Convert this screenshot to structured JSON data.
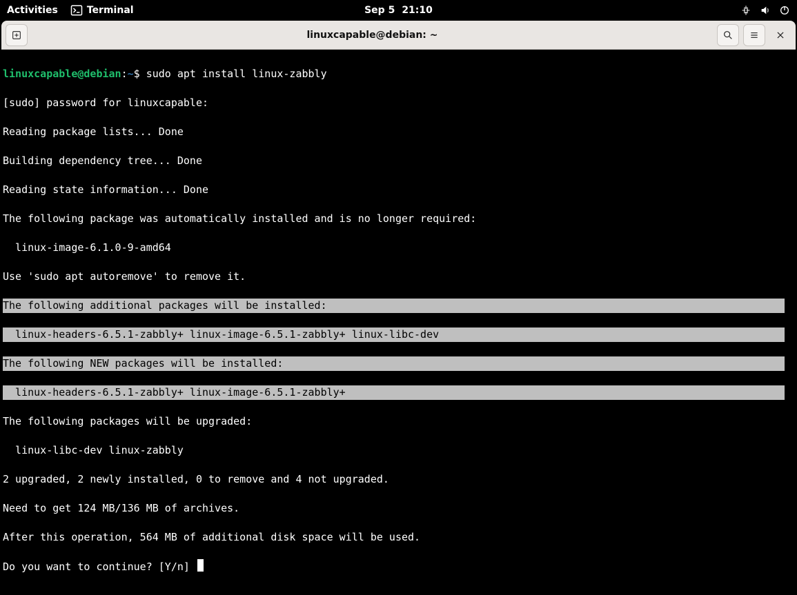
{
  "topbar": {
    "activities": "Activities",
    "app_label": "Terminal",
    "date": "Sep 5",
    "time": "21:10"
  },
  "window": {
    "title": "linuxcapable@debian: ~"
  },
  "prompt": {
    "user_host": "linuxcapable@debian",
    "sep": ":",
    "cwd": "~",
    "symbol": "$ ",
    "command": "sudo apt install linux-zabbly"
  },
  "lines": {
    "l1": "[sudo] password for linuxcapable:",
    "l2": "Reading package lists... Done",
    "l3": "Building dependency tree... Done",
    "l4": "Reading state information... Done",
    "l5": "The following package was automatically installed and is no longer required:",
    "l6": "  linux-image-6.1.0-9-amd64",
    "l7": "Use 'sudo apt autoremove' to remove it.",
    "h1": "The following additional packages will be installed:",
    "h2": "  linux-headers-6.5.1-zabbly+ linux-image-6.5.1-zabbly+ linux-libc-dev",
    "h3": "The following NEW packages will be installed:",
    "h4": "  linux-headers-6.5.1-zabbly+ linux-image-6.5.1-zabbly+",
    "l8": "The following packages will be upgraded:",
    "l9": "  linux-libc-dev linux-zabbly",
    "l10": "2 upgraded, 2 newly installed, 0 to remove and 4 not upgraded.",
    "l11": "Need to get 124 MB/136 MB of archives.",
    "l12": "After this operation, 564 MB of additional disk space will be used.",
    "l13": "Do you want to continue? [Y/n] "
  }
}
